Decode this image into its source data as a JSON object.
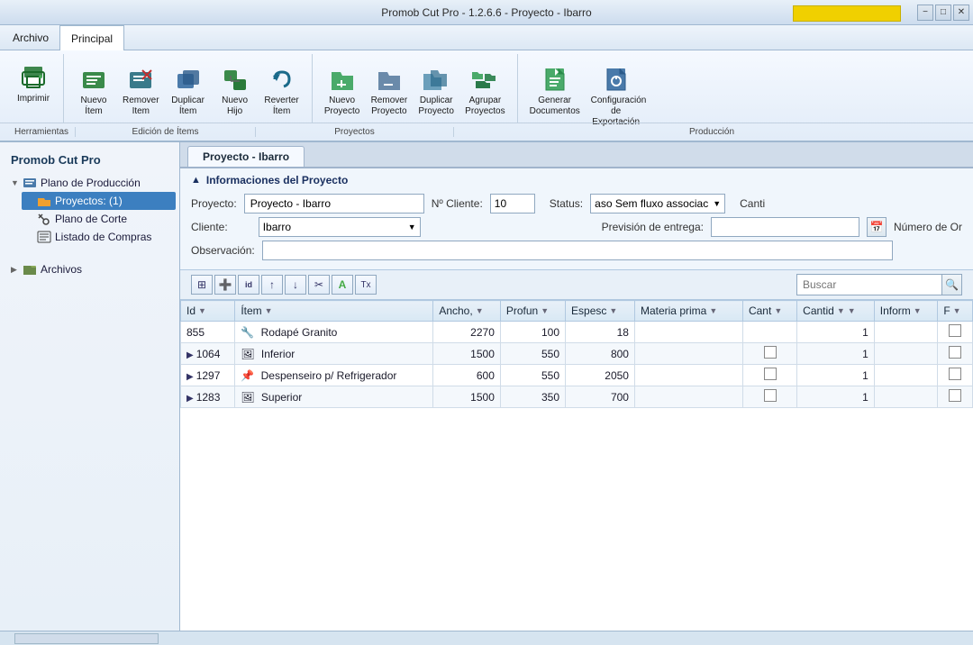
{
  "titleBar": {
    "title": "Promob Cut Pro - 1.2.6.6 - Proyecto - Ibarro",
    "minimizeLabel": "−",
    "maximizeLabel": "□",
    "closeLabel": "✕"
  },
  "menuBar": {
    "items": [
      {
        "id": "archivo",
        "label": "Archivo"
      },
      {
        "id": "principal",
        "label": "Principal"
      }
    ]
  },
  "ribbon": {
    "groups": [
      {
        "id": "herramientas",
        "label": "Herramientas",
        "buttons": [
          {
            "id": "imprimir",
            "label": "Imprimir",
            "icon": "🖨"
          }
        ]
      },
      {
        "id": "edicion-items",
        "label": "Edición de Ítems",
        "buttons": [
          {
            "id": "nuevo-item",
            "label": "Nuevo\nÍtem",
            "icon": "📦"
          },
          {
            "id": "remover-item",
            "label": "Remover\nItem",
            "icon": "📦"
          },
          {
            "id": "duplicar-item",
            "label": "Duplicar\nÍtem",
            "icon": "📦"
          },
          {
            "id": "nuevo-hijo",
            "label": "Nuevo\nHijo",
            "icon": "📦"
          },
          {
            "id": "reverter-item",
            "label": "Reverter\nÍtem",
            "icon": "↩"
          }
        ]
      },
      {
        "id": "proyectos",
        "label": "Proyectos",
        "buttons": [
          {
            "id": "nuevo-proyecto",
            "label": "Nuevo\nProyecto",
            "icon": "📁"
          },
          {
            "id": "remover-proyecto",
            "label": "Remover\nProyecto",
            "icon": "📁"
          },
          {
            "id": "duplicar-proyecto",
            "label": "Duplicar\nProyecto",
            "icon": "📁"
          },
          {
            "id": "agrupar-proyectos",
            "label": "Agrupar\nProyectos",
            "icon": "📁"
          }
        ]
      },
      {
        "id": "produccion",
        "label": "Producción",
        "buttons": [
          {
            "id": "generar-doc",
            "label": "Generar\nDocumentos",
            "icon": "📄"
          },
          {
            "id": "config-exportacion",
            "label": "Configuración\nde Exportación",
            "icon": "⚙"
          }
        ]
      }
    ]
  },
  "sidebar": {
    "title": "Promob Cut Pro",
    "tree": [
      {
        "id": "plano-produccion",
        "label": "Plano de Producción",
        "icon": "🗂",
        "expanded": true,
        "children": [
          {
            "id": "proyectos",
            "label": "Proyectos: (1)",
            "icon": "📁",
            "selected": true
          },
          {
            "id": "plano-corte",
            "label": "Plano de Corte",
            "icon": "✂"
          },
          {
            "id": "listado-compras",
            "label": "Listado de Compras",
            "icon": "☰"
          }
        ]
      },
      {
        "id": "archivos",
        "label": "Archivos",
        "icon": "🗃",
        "expanded": false,
        "children": []
      }
    ]
  },
  "mainTab": {
    "label": "Proyecto - Ibarro"
  },
  "projectInfo": {
    "sectionTitle": "Informaciones del Proyecto",
    "proyectoLabel": "Proyecto:",
    "proyectoValue": "Proyecto - Ibarro",
    "nroClienteLabel": "Nº Cliente:",
    "nroClienteValue": "10",
    "statusLabel": "Status:",
    "statusValue": "aso Sem fluxo associac",
    "cantiLabel": "Canti",
    "clienteLabel": "Cliente:",
    "clienteValue": "Ibarro",
    "previsionLabel": "Previsión de entrega:",
    "previsionValue": "",
    "numeroOrLabel": "Número de Or",
    "observacionLabel": "Observación:",
    "observacionValue": ""
  },
  "toolbar": {
    "searchPlaceholder": "Buscar",
    "buttons": [
      "⊞",
      "➕",
      "id",
      "↑",
      "↓",
      "✂",
      "A",
      "Tx"
    ]
  },
  "table": {
    "columns": [
      {
        "id": "id",
        "label": "Id"
      },
      {
        "id": "item",
        "label": "Ítem"
      },
      {
        "id": "ancho",
        "label": "Ancho,"
      },
      {
        "id": "profun",
        "label": "Profun"
      },
      {
        "id": "espesc",
        "label": "Espesc"
      },
      {
        "id": "materia",
        "label": "Materia prima"
      },
      {
        "id": "cant",
        "label": "Cant"
      },
      {
        "id": "cantid",
        "label": "Cantid"
      },
      {
        "id": "inform",
        "label": "Inform"
      },
      {
        "id": "f",
        "label": "F"
      }
    ],
    "rows": [
      {
        "id": "855",
        "item": "Rodapé Granito",
        "ancho": "2270",
        "profun": "100",
        "espesc": "18",
        "materia": "",
        "cant": "",
        "cantid": "1",
        "inform": "",
        "f": false,
        "hasExpand": false,
        "icon": "🔧"
      },
      {
        "id": "1064",
        "item": "Inferior",
        "ancho": "1500",
        "profun": "550",
        "espesc": "800",
        "materia": "",
        "cant": "☐",
        "cantid": "1",
        "inform": "",
        "f": false,
        "hasExpand": true,
        "icon": "📷"
      },
      {
        "id": "1297",
        "item": "Despenseiro p/ Refrigerador",
        "ancho": "600",
        "profun": "550",
        "espesc": "2050",
        "materia": "",
        "cant": "☐",
        "cantid": "1",
        "inform": "",
        "f": false,
        "hasExpand": true,
        "icon": "📌"
      },
      {
        "id": "1283",
        "item": "Superior",
        "ancho": "1500",
        "profun": "350",
        "espesc": "700",
        "materia": "",
        "cant": "☐",
        "cantid": "1",
        "inform": "",
        "f": false,
        "hasExpand": true,
        "icon": "📷"
      }
    ]
  }
}
